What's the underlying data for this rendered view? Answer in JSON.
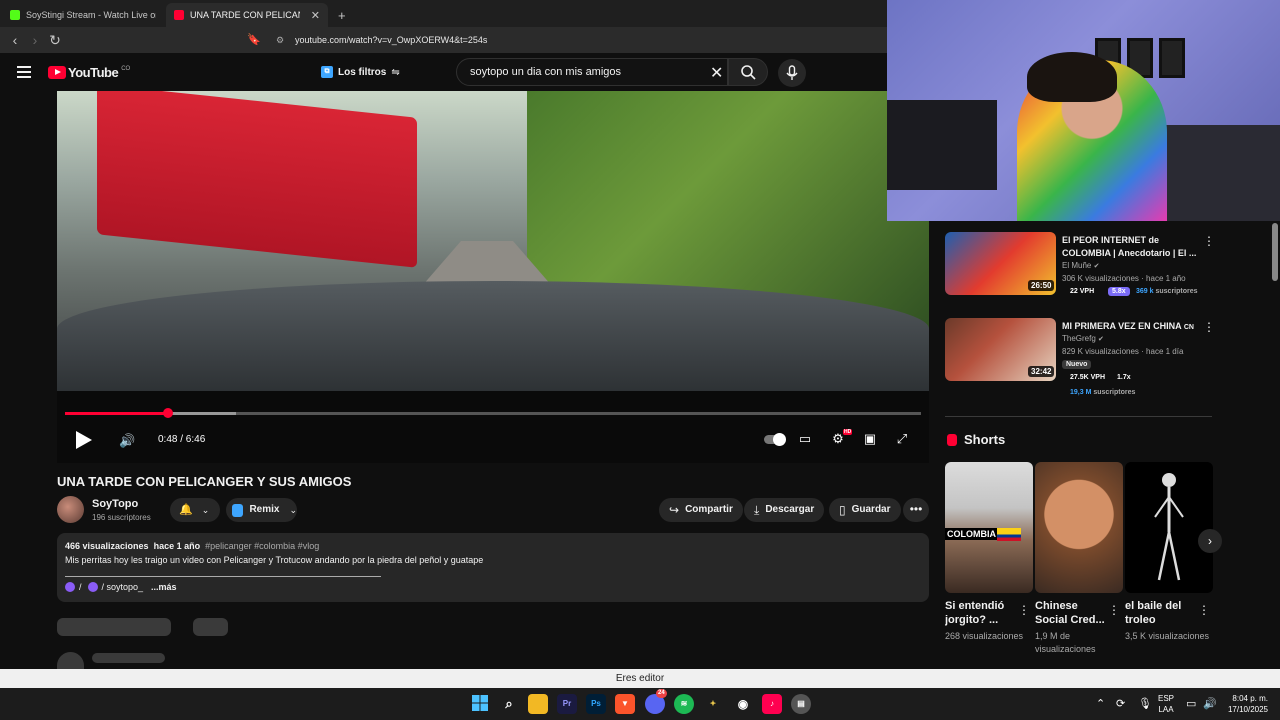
{
  "browser": {
    "tabs": [
      {
        "title": "SoyStingi Stream - Watch Live on Kick",
        "favicon_color": "#53fc18",
        "active": false
      },
      {
        "title": "UNA TARDE CON PELICANGER",
        "favicon_color": "#ff0033",
        "active": true
      }
    ],
    "new_tab_label": "+",
    "url": "youtube.com/watch?v=v_OwpXOERW4&t=254s"
  },
  "youtube": {
    "logo_text": "YouTube",
    "country_code": "CO",
    "filters_label": "Los filtros",
    "search_query": "soytopo un dia con mis amigos"
  },
  "player": {
    "current_time": "0:48",
    "duration": "6:46",
    "time_display": "0:48 / 6:46",
    "progress_fraction": 0.12,
    "buffered_fraction": 0.2,
    "hd_badge": "HD"
  },
  "video": {
    "title": "UNA TARDE CON PELICANGER Y SUS AMIGOS",
    "channel": "SoyTopo",
    "subscribers": "196 suscriptores",
    "remix_label": "Remix",
    "share_label": "Compartir",
    "download_label": "Descargar",
    "save_label": "Guardar",
    "views": "466 visualizaciones",
    "age": "hace 1 año",
    "tags": "#pelicanger #colombia #vlog",
    "description": "Mis perritas hoy les traigo un video con Pelicanger y Trotucow andando por la piedra del peñol y guatape",
    "link_sep": "/",
    "link_text": "/ soytopo_",
    "more_label": "...más"
  },
  "recommendations": [
    {
      "title": "El PEOR INTERNET de COLOMBIA | Anecdotario | El ...",
      "channel": "El Muñe",
      "stats": "306 K visualizaciones · hace 1 año",
      "duration": "26:50",
      "vph": "22 VPH",
      "mult": "5.8x",
      "subs_value": "369 k",
      "subs_label": "suscriptores"
    },
    {
      "title": "MI PRIMERA VEZ EN CHINA",
      "title_suffix": "CN",
      "channel": "TheGrefg",
      "stats": "829 K visualizaciones · hace 1 día",
      "duration": "32:42",
      "new_badge": "Nuevo",
      "vph": "27.5K VPH",
      "mult": "1.7x",
      "subs_value": "19,3 M",
      "subs_label": "suscriptores"
    }
  ],
  "shorts": {
    "heading": "Shorts",
    "items": [
      {
        "title": "Si entendió jorgito? ...",
        "views": "268 visualizaciones",
        "overlay": "COLOMBIA"
      },
      {
        "title": "Chinese Social Cred...",
        "views": "1,9 M de visualizaciones",
        "overlay": ""
      },
      {
        "title": "el baile del troleo",
        "views": "3,5 K visualizaciones",
        "overlay": ""
      }
    ]
  },
  "notice": "Eres editor",
  "taskbar": {
    "lang_top": "ESP",
    "lang_bottom": "LAA",
    "time": "8:04 p. m.",
    "date": "17/10/2025",
    "discord_badge": "24"
  },
  "colors": {
    "accent": "#ff0033",
    "link_blue": "#3ea6ff",
    "background": "#0f0f0f"
  }
}
